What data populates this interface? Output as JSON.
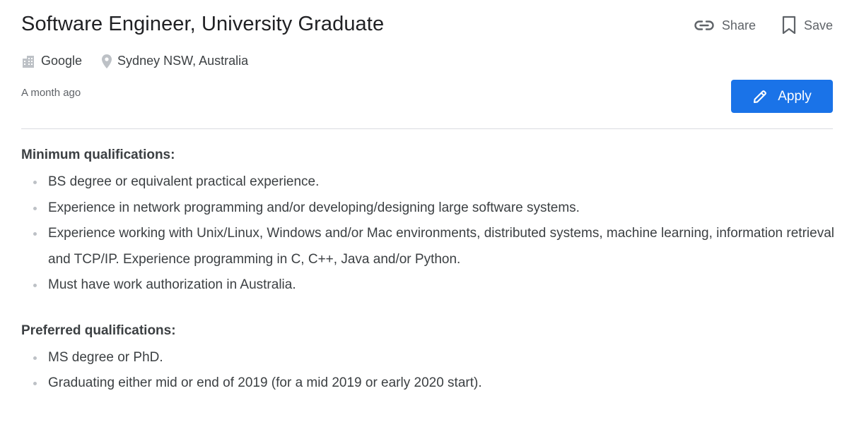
{
  "job": {
    "title": "Software Engineer, University Graduate",
    "company": "Google",
    "location": "Sydney NSW, Australia",
    "posted": "A month ago"
  },
  "actions": {
    "share_label": "Share",
    "save_label": "Save",
    "apply_label": "Apply"
  },
  "icons": {
    "company": "building-icon",
    "location": "location-pin-icon",
    "share": "link-icon",
    "save": "bookmark-icon",
    "apply": "pencil-icon"
  },
  "colors": {
    "accent": "#1a73e8",
    "text": "#202124",
    "muted": "#5f6368"
  },
  "minimum_qualifications": {
    "heading": "Minimum qualifications:",
    "items": [
      "BS degree or equivalent practical experience.",
      "Experience in network programming and/or developing/designing large software systems.",
      "Experience working with Unix/Linux, Windows and/or Mac environments, distributed systems, machine learning, information retrieval and TCP/IP. Experience programming in C, C++, Java and/or Python.",
      "Must have work authorization in Australia."
    ]
  },
  "preferred_qualifications": {
    "heading": "Preferred qualifications:",
    "items": [
      "MS degree or PhD.",
      "Graduating either mid or end of 2019 (for a mid 2019 or early 2020 start)."
    ]
  }
}
